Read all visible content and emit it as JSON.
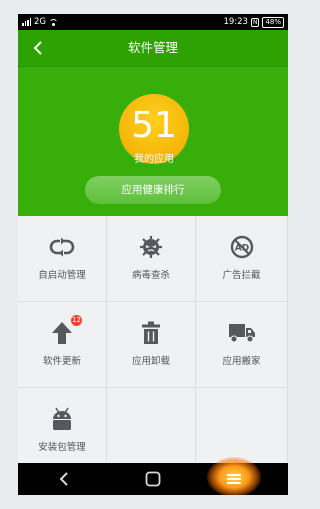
{
  "status_bar": {
    "network": "2G",
    "time": "19:23",
    "battery": "48%"
  },
  "app": {
    "title": "软件管理"
  },
  "summary": {
    "app_count": "51",
    "app_count_label": "我的应用",
    "rank_button_label": "应用健康排行"
  },
  "grid": {
    "items": [
      {
        "label": "自启动管理",
        "icon": "autostart-icon"
      },
      {
        "label": "病毒查杀",
        "icon": "virus-scan-icon"
      },
      {
        "label": "广告拦截",
        "icon": "ad-block-icon"
      },
      {
        "label": "软件更新",
        "icon": "update-arrow-icon",
        "badge": "12"
      },
      {
        "label": "应用卸载",
        "icon": "trash-icon"
      },
      {
        "label": "应用搬家",
        "icon": "truck-icon"
      },
      {
        "label": "安装包管理",
        "icon": "android-icon"
      }
    ]
  },
  "colors": {
    "header_green": "#37ae0a",
    "count_circle": "#f6b90c",
    "badge_red": "#f0432b"
  }
}
